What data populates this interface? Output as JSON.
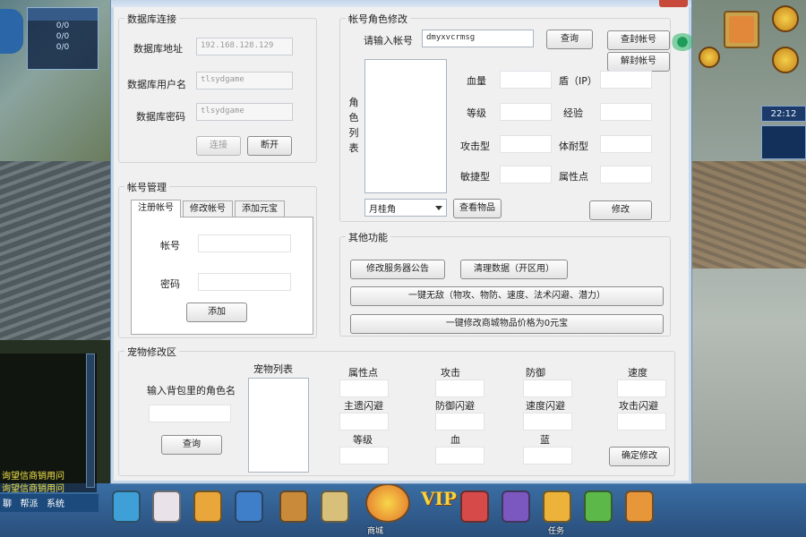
{
  "background": {
    "status_rows": [
      "0/0",
      "0/0",
      "0/0"
    ],
    "clock": "22:12",
    "chat_lines": [
      "询望信商销用问",
      "询望信商销用问"
    ],
    "chat_tabs": [
      "聊",
      "帮派",
      "系统"
    ],
    "toolbar_labels": [
      "商城",
      "商城",
      "VIP",
      "任务"
    ]
  },
  "db": {
    "legend": "数据库连接",
    "address_label": "数据库地址",
    "address_value": "192.168.128.129",
    "user_label": "数据库用户名",
    "user_value": "tlsydgame",
    "password_label": "数据库密码",
    "password_value": "tlsydgame",
    "connect_label": "连接",
    "disconnect_label": "断开"
  },
  "account": {
    "legend": "帐号角色修改",
    "prompt_label": "请输入帐号",
    "account_value": "dmyxvcrmsg",
    "query_label": "查询",
    "ban_label": "查封帐号",
    "unban_label": "解封帐号",
    "role_list_label": [
      "角",
      "色",
      "列",
      "表"
    ],
    "fields_left": [
      "血量",
      "等级",
      "攻击型",
      "敏捷型"
    ],
    "fields_right": [
      "盾（IP）",
      "经验",
      "体耐型",
      "属性点"
    ],
    "dropdown_value": "月桂角",
    "view_items_label": "查看物品",
    "modify_label": "修改"
  },
  "account_mgmt": {
    "legend": "帐号管理",
    "tabs": [
      "注册帐号",
      "修改帐号",
      "添加元宝"
    ],
    "account_label": "帐号",
    "password_label": "密码",
    "add_label": "添加"
  },
  "other": {
    "legend": "其他功能",
    "announce_label": "修改服务器公告",
    "clear_label": "清理数据（开区用）",
    "one_click_label": "一键无敌（物攻、物防、速度、法术闪避、潜力）",
    "zero_price_label": "一键修改商城物品价格为0元宝"
  },
  "pet": {
    "legend": "宠物修改区",
    "prompt_label": "输入背包里的角色名",
    "list_label": "宠物列表",
    "query_label": "查询",
    "attr_labels": [
      "属性点",
      "攻击",
      "防御",
      "速度"
    ],
    "attr_labels_2": [
      "主遗闪避",
      "防御闪避",
      "速度闪避",
      "攻击闪避"
    ],
    "attr_labels_3": [
      "等级",
      "血",
      "蓝"
    ],
    "confirm_label": "确定修改"
  }
}
